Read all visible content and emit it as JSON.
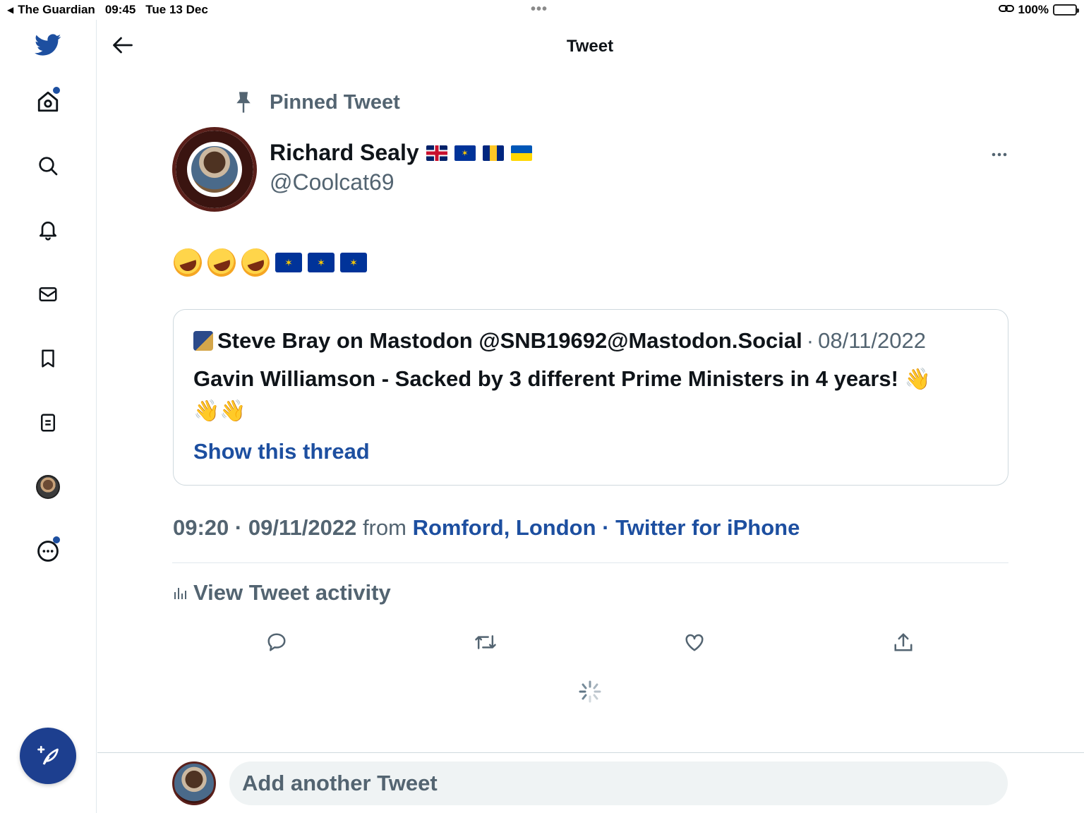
{
  "status_bar": {
    "back_app": "The Guardian",
    "time": "09:45",
    "date": "Tue 13 Dec",
    "battery": "100%"
  },
  "header": {
    "title": "Tweet"
  },
  "sidebar": {
    "items": [
      {
        "name": "home",
        "icon": "home-icon",
        "has_dot": true
      },
      {
        "name": "explore",
        "icon": "search-icon"
      },
      {
        "name": "notifications",
        "icon": "bell-icon"
      },
      {
        "name": "messages",
        "icon": "mail-icon"
      },
      {
        "name": "bookmarks",
        "icon": "bookmark-icon"
      },
      {
        "name": "lists",
        "icon": "lists-icon"
      },
      {
        "name": "profile",
        "icon": "avatar"
      },
      {
        "name": "more",
        "icon": "more-circle-icon",
        "has_dot": true
      }
    ],
    "compose_icon": "compose-feather-icon"
  },
  "tweet": {
    "pinned_label": "Pinned Tweet",
    "author_name": "Richard Sealy",
    "author_flags": [
      "uk-flag",
      "eu-flag",
      "barbados-flag",
      "ukraine-flag"
    ],
    "handle": "@Coolcat69",
    "body_emojis": [
      "rolling-laughing",
      "rolling-laughing",
      "rolling-laughing",
      "eu-flag",
      "eu-flag",
      "eu-flag"
    ],
    "quote": {
      "author": "Steve Bray on Mastodon @SNB19692@Mastodon.Social",
      "separator": "·",
      "date": "08/11/2022",
      "text": "Gavin Williamson - Sacked by 3 different Prime Ministers in 4 years!",
      "thread_link": "Show this thread"
    },
    "meta": {
      "time": "09:20",
      "date": "09/11/2022",
      "from": "from",
      "location": "Romford, London",
      "client": "Twitter for iPhone"
    },
    "activity_label": "View Tweet activity"
  },
  "reply": {
    "placeholder": "Add another Tweet"
  },
  "colors": {
    "accent": "#1d4fa0",
    "compose_bg": "#1d3f8f",
    "secondary_text": "#536471"
  }
}
